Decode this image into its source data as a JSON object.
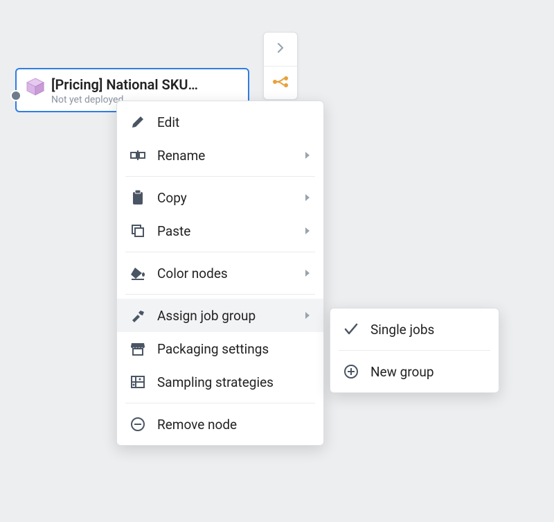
{
  "node": {
    "title": "[Pricing] National SKU…",
    "status": "Not yet deployed"
  },
  "menu": {
    "edit": "Edit",
    "rename": "Rename",
    "copy": "Copy",
    "paste": "Paste",
    "color_nodes": "Color nodes",
    "assign_job_group": "Assign job group",
    "packaging_settings": "Packaging settings",
    "sampling_strategies": "Sampling strategies",
    "remove_node": "Remove node"
  },
  "submenu": {
    "single_jobs": "Single jobs",
    "new_group": "New group"
  },
  "colors": {
    "icon": "#4a5564",
    "chevron": "#9aa3af",
    "brand_orange": "#e8a13a",
    "cube_light": "#e7c9ef",
    "cube_dark": "#c89dd6"
  }
}
